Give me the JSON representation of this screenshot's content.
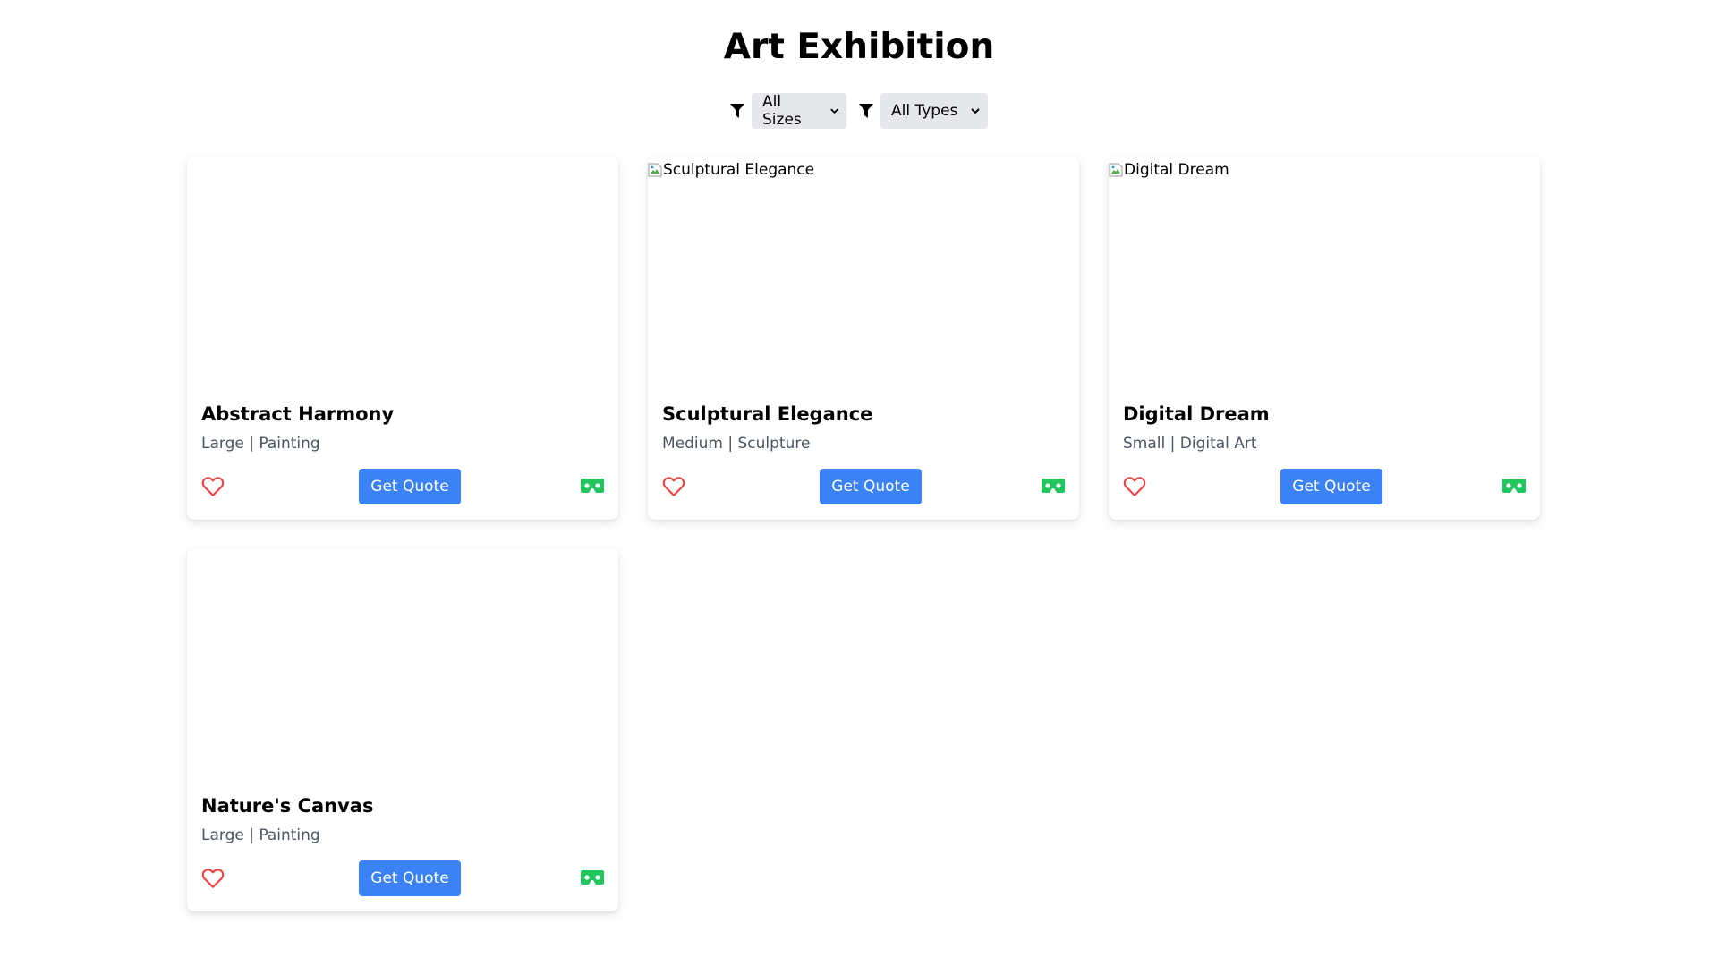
{
  "header": {
    "title": "Art Exhibition"
  },
  "filters": {
    "size": {
      "selected": "All Sizes"
    },
    "type": {
      "selected": "All Types"
    }
  },
  "artworks": [
    {
      "title": "Abstract Harmony",
      "meta": "Large | Painting",
      "image_alt": "",
      "quote_label": "Get Quote"
    },
    {
      "title": "Sculptural Elegance",
      "meta": "Medium | Sculpture",
      "image_alt": "Sculptural Elegance",
      "quote_label": "Get Quote"
    },
    {
      "title": "Digital Dream",
      "meta": "Small | Digital Art",
      "image_alt": "Digital Dream",
      "quote_label": "Get Quote"
    },
    {
      "title": "Nature's Canvas",
      "meta": "Large | Painting",
      "image_alt": "",
      "quote_label": "Get Quote"
    }
  ],
  "icons": {
    "filter": "filter-icon",
    "favorite": "heart-icon",
    "vr": "vr-headset-icon",
    "broken_image": "broken-image-icon"
  },
  "colors": {
    "accent": "#3b82f6",
    "favorite": "#ef4444",
    "vr": "#22c55e",
    "select_bg": "#e5e7eb",
    "meta_text": "#4b5563"
  }
}
